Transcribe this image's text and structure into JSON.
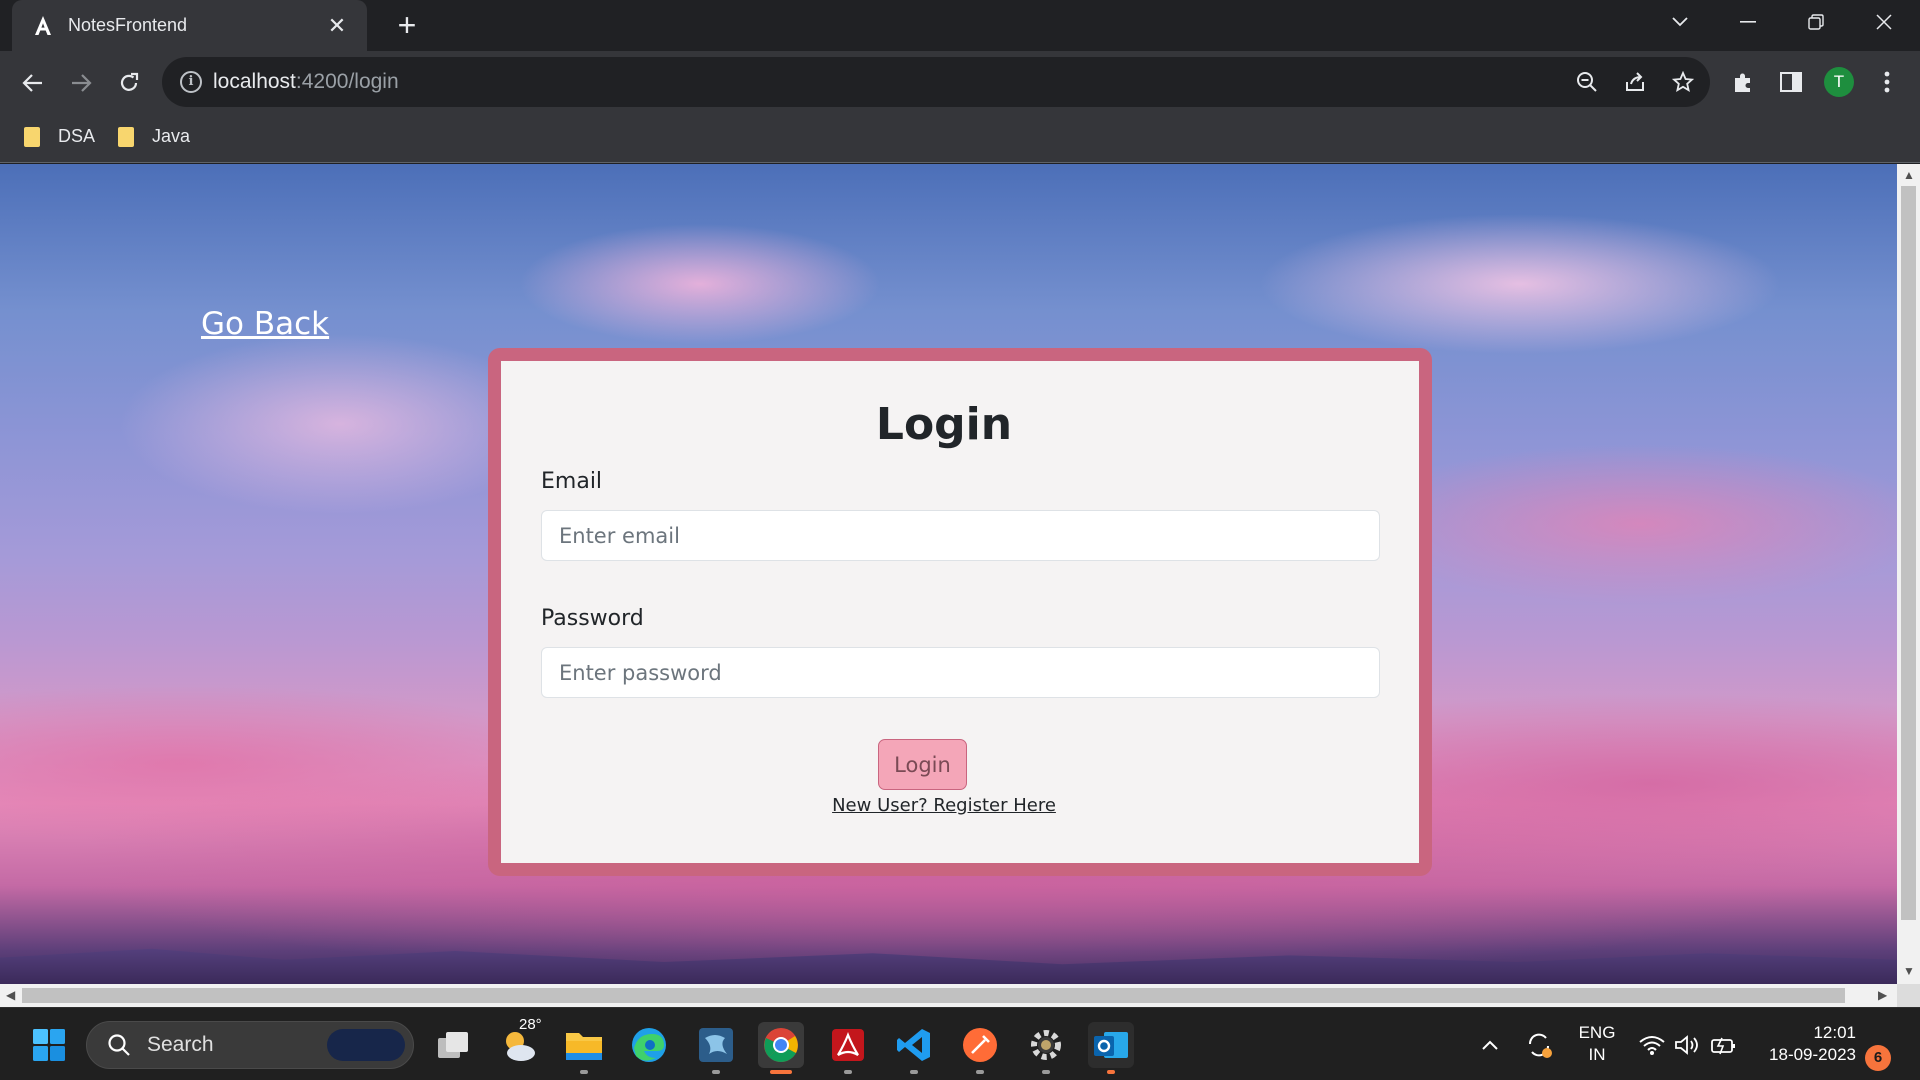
{
  "browser": {
    "tab_title": "NotesFrontend",
    "url_host": "localhost",
    "url_path": ":4200/login",
    "profile_initial": "T",
    "bookmarks": [
      {
        "label": "DSA"
      },
      {
        "label": "Java"
      }
    ]
  },
  "page": {
    "go_back": "Go Back",
    "title": "Login",
    "email_label": "Email",
    "email_placeholder": "Enter email",
    "email_value": "",
    "password_label": "Password",
    "password_placeholder": "Enter password",
    "password_value": "",
    "login_button": "Login",
    "register_link": "New User? Register Here"
  },
  "taskbar": {
    "search_label": "Search",
    "weather_temp": "28°",
    "language": "ENG",
    "region": "IN",
    "time": "12:01",
    "date": "18-09-2023",
    "notification_count": "6"
  },
  "colors": {
    "card_border": "#c9657f",
    "card_bg": "#f5f3f3",
    "button_bg": "#f4a6b8"
  }
}
